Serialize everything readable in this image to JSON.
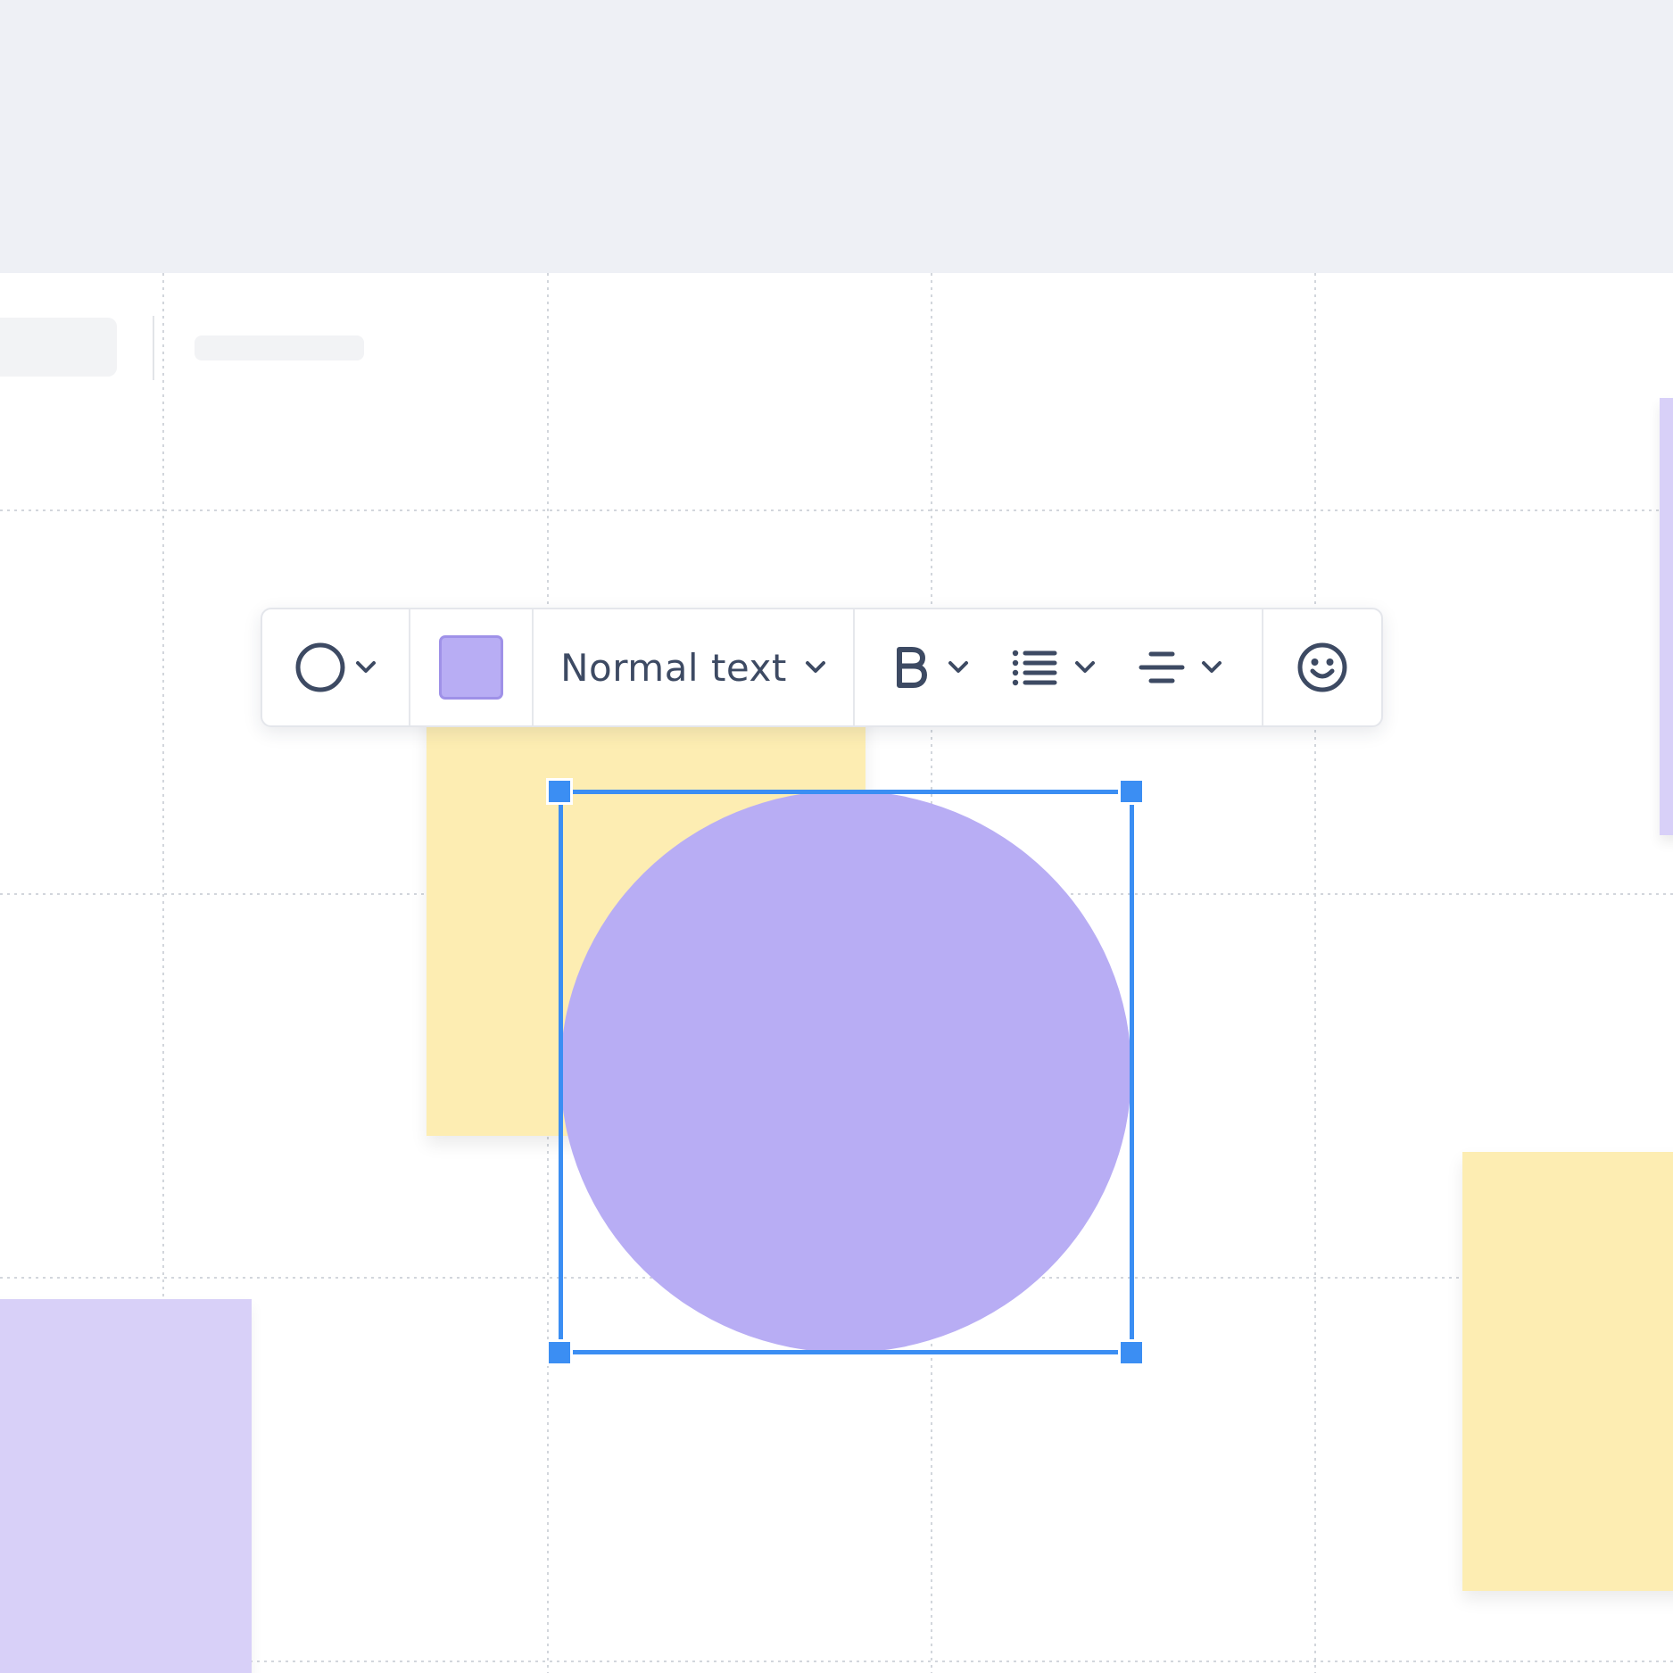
{
  "canvas": {
    "background": "#ffffff",
    "topband_color": "#eef0f5",
    "grid_color": "#d2d6dc"
  },
  "toolbar": {
    "shape_icon": "circle-icon",
    "fill_color": "#b8adf4",
    "text_style_label": "Normal text",
    "bold_icon": "bold-icon",
    "list_icon": "bullet-list-icon",
    "align_icon": "align-center-icon",
    "emoji_icon": "smiley-icon",
    "dropdown_icon": "chevron-down-icon",
    "icon_color": "#3d4a63"
  },
  "selection": {
    "shape": "circle",
    "shape_fill": "#b8adf4",
    "handle_color": "#3b8ef3"
  },
  "stickies": [
    {
      "name": "sticky-note-yellow",
      "color": "#fdedb2"
    },
    {
      "name": "sticky-note-purple",
      "color": "#d8d0f8"
    }
  ]
}
